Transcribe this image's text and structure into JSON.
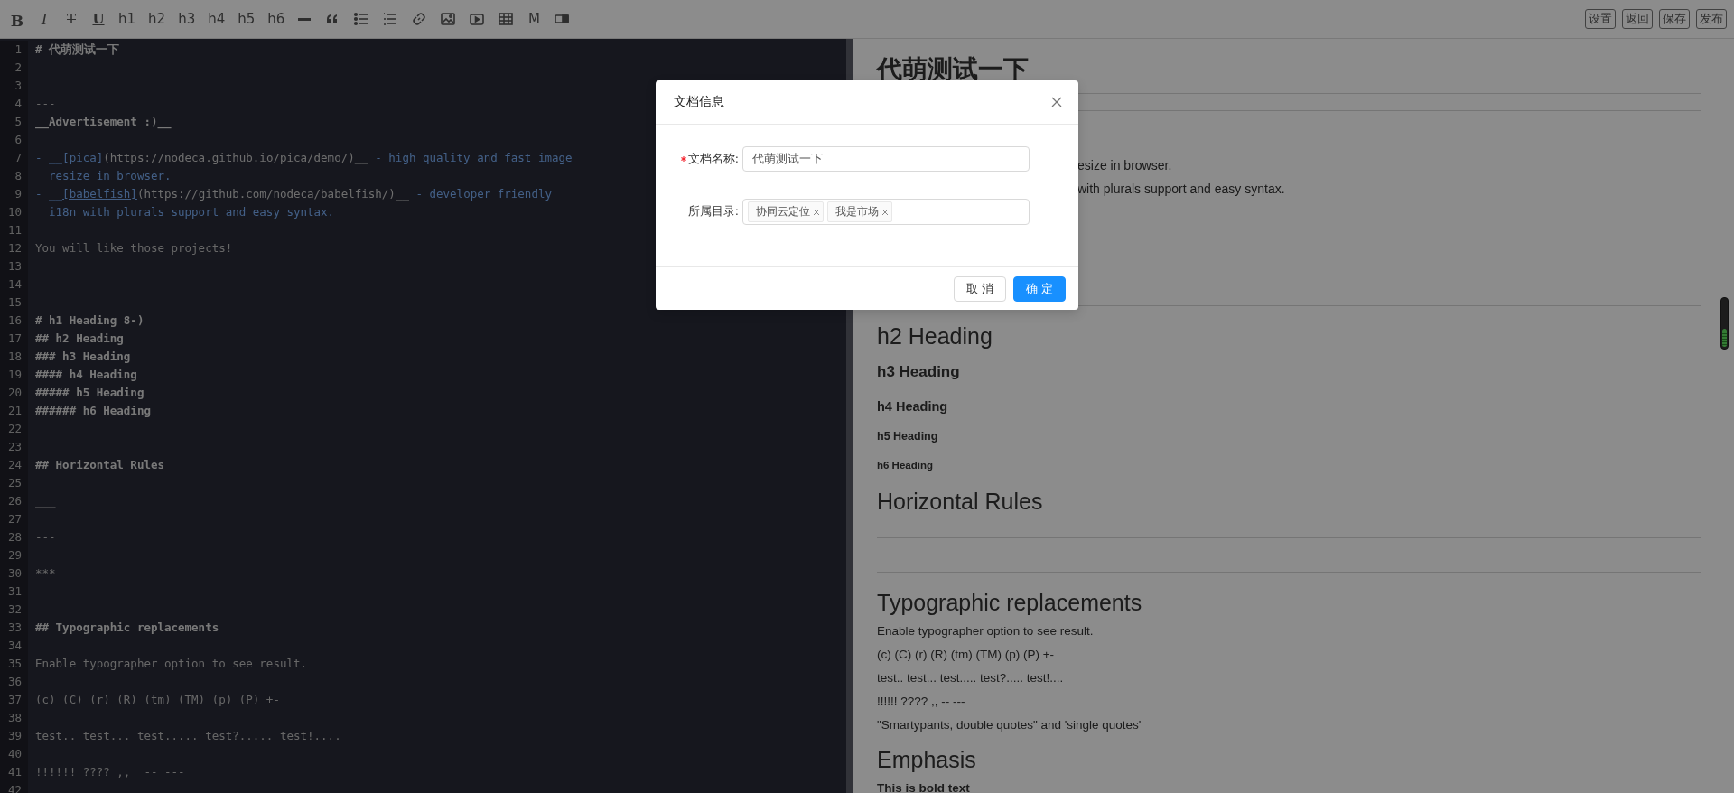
{
  "toolbar": {
    "tools": [
      {
        "kind": "bold",
        "label": "B"
      },
      {
        "kind": "italic",
        "label": "I"
      },
      {
        "kind": "strike",
        "label": "T"
      },
      {
        "kind": "underline",
        "label": "U"
      },
      {
        "kind": "plain",
        "label": "h1"
      },
      {
        "kind": "plain",
        "label": "h2"
      },
      {
        "kind": "plain",
        "label": "h3"
      },
      {
        "kind": "plain",
        "label": "h4"
      },
      {
        "kind": "plain",
        "label": "h5"
      },
      {
        "kind": "plain",
        "label": "h6"
      },
      {
        "kind": "rule"
      },
      {
        "kind": "quote"
      },
      {
        "kind": "bullets"
      },
      {
        "kind": "numbers"
      },
      {
        "kind": "link"
      },
      {
        "kind": "image"
      },
      {
        "kind": "video"
      },
      {
        "kind": "table"
      },
      {
        "kind": "plain",
        "label": "M"
      },
      {
        "kind": "toggle"
      }
    ],
    "actions": [
      "设置",
      "返回",
      "保存",
      "发布"
    ]
  },
  "editor": {
    "lines": [
      {
        "number": "1",
        "segments": [
          {
            "kind": "heading",
            "text": "# 代萌测试一下"
          }
        ]
      },
      {
        "number": "2"
      },
      {
        "number": "3"
      },
      {
        "number": "4",
        "segments": [
          {
            "kind": "plain",
            "text": "---"
          }
        ]
      },
      {
        "number": "5",
        "segments": [
          {
            "kind": "strong",
            "text": "__Advertisement :)__"
          }
        ]
      },
      {
        "number": "6"
      },
      {
        "number": "7",
        "segments": [
          {
            "kind": "blue",
            "text": "- __"
          },
          {
            "kind": "link",
            "text": "[pica]"
          },
          {
            "kind": "url",
            "text": "(https://nodeca.github.io/pica/demo/)__"
          },
          {
            "kind": "blue",
            "text": " - high quality and fast image"
          }
        ]
      },
      {
        "number": "8",
        "segments": [
          {
            "kind": "blue",
            "text": "  resize in browser."
          }
        ]
      },
      {
        "number": "9",
        "segments": [
          {
            "kind": "blue",
            "text": "- __"
          },
          {
            "kind": "link",
            "text": "[babelfish]"
          },
          {
            "kind": "url",
            "text": "(https://github.com/nodeca/babelfish/)__"
          },
          {
            "kind": "blue",
            "text": " - developer friendly"
          }
        ]
      },
      {
        "number": "10",
        "segments": [
          {
            "kind": "blue",
            "text": "  i18n with plurals support and easy syntax."
          }
        ]
      },
      {
        "number": "11"
      },
      {
        "number": "12",
        "segments": [
          {
            "kind": "plain",
            "text": "You will like those projects!"
          }
        ]
      },
      {
        "number": "13"
      },
      {
        "number": "14",
        "segments": [
          {
            "kind": "plain",
            "text": "---"
          }
        ]
      },
      {
        "number": "15"
      },
      {
        "number": "16",
        "segments": [
          {
            "kind": "heading",
            "text": "# h1 Heading 8-)"
          }
        ]
      },
      {
        "number": "17",
        "segments": [
          {
            "kind": "heading",
            "text": "## h2 Heading"
          }
        ]
      },
      {
        "number": "18",
        "segments": [
          {
            "kind": "heading",
            "text": "### h3 Heading"
          }
        ]
      },
      {
        "number": "19",
        "segments": [
          {
            "kind": "heading",
            "text": "#### h4 Heading"
          }
        ]
      },
      {
        "number": "20",
        "segments": [
          {
            "kind": "heading",
            "text": "##### h5 Heading"
          }
        ]
      },
      {
        "number": "21",
        "segments": [
          {
            "kind": "heading",
            "text": "###### h6 Heading"
          }
        ]
      },
      {
        "number": "22"
      },
      {
        "number": "23"
      },
      {
        "number": "24",
        "segments": [
          {
            "kind": "heading",
            "text": "## Horizontal Rules"
          }
        ]
      },
      {
        "number": "25"
      },
      {
        "number": "26",
        "segments": [
          {
            "kind": "plain",
            "text": "___"
          }
        ]
      },
      {
        "number": "27"
      },
      {
        "number": "28",
        "segments": [
          {
            "kind": "plain",
            "text": "---"
          }
        ]
      },
      {
        "number": "29"
      },
      {
        "number": "30",
        "segments": [
          {
            "kind": "plain",
            "text": "***"
          }
        ]
      },
      {
        "number": "31"
      },
      {
        "number": "32"
      },
      {
        "number": "33",
        "segments": [
          {
            "kind": "heading",
            "text": "## Typographic replacements"
          }
        ]
      },
      {
        "number": "34"
      },
      {
        "number": "35",
        "segments": [
          {
            "kind": "plain",
            "text": "Enable typographer option to see result."
          }
        ]
      },
      {
        "number": "36"
      },
      {
        "number": "37",
        "segments": [
          {
            "kind": "plain",
            "text": "(c) (C) (r) (R) (tm) (TM) (p) (P) +-"
          }
        ]
      },
      {
        "number": "38"
      },
      {
        "number": "39",
        "segments": [
          {
            "kind": "plain",
            "text": "test.. test... test..... test?..... test!...."
          }
        ]
      },
      {
        "number": "40"
      },
      {
        "number": "41",
        "segments": [
          {
            "kind": "plain",
            "text": "!!!!!! ???? ,,  -- ---"
          }
        ]
      },
      {
        "number": "42"
      }
    ]
  },
  "preview": {
    "blocks": [
      {
        "kind": "h1",
        "text": "代萌测试一下"
      },
      {
        "kind": "hr"
      },
      {
        "kind": "tail",
        "text": "esize in browser."
      },
      {
        "kind": "tail",
        "text": "with plurals support and easy syntax."
      },
      {
        "kind": "hr"
      },
      {
        "kind": "h2",
        "text": "h2 Heading"
      },
      {
        "kind": "h3",
        "text": "h3 Heading"
      },
      {
        "kind": "h4",
        "text": "h4 Heading"
      },
      {
        "kind": "h5",
        "text": "h5 Heading"
      },
      {
        "kind": "h6",
        "text": "h6 Heading"
      },
      {
        "kind": "h2",
        "text": "Horizontal Rules"
      },
      {
        "kind": "hr"
      },
      {
        "kind": "hr"
      },
      {
        "kind": "hr"
      },
      {
        "kind": "h2",
        "text": "Typographic replacements"
      },
      {
        "kind": "p",
        "text": "Enable typographer option to see result."
      },
      {
        "kind": "p",
        "text": "(c) (C) (r) (R) (tm) (TM) (p) (P) +-"
      },
      {
        "kind": "p",
        "text": "test.. test... test..... test?..... test!...."
      },
      {
        "kind": "p",
        "text": "!!!!!! ???? ,,  -- ---"
      },
      {
        "kind": "p",
        "text": "\"Smartypants, double quotes\" and 'single quotes'"
      },
      {
        "kind": "h2",
        "text": "Emphasis"
      },
      {
        "kind": "bold",
        "text": "This is bold text"
      }
    ]
  },
  "dialog": {
    "title": "文档信息",
    "fields": [
      {
        "kind": "input",
        "label": "文档名称:",
        "required": true,
        "value": "代萌测试一下"
      },
      {
        "kind": "tags",
        "label": "所属目录:",
        "required": false,
        "tags": [
          "协同云定位",
          "我是市场"
        ]
      }
    ],
    "buttons": [
      {
        "label": "取 消",
        "primary": false
      },
      {
        "label": "确 定",
        "primary": true
      }
    ]
  }
}
